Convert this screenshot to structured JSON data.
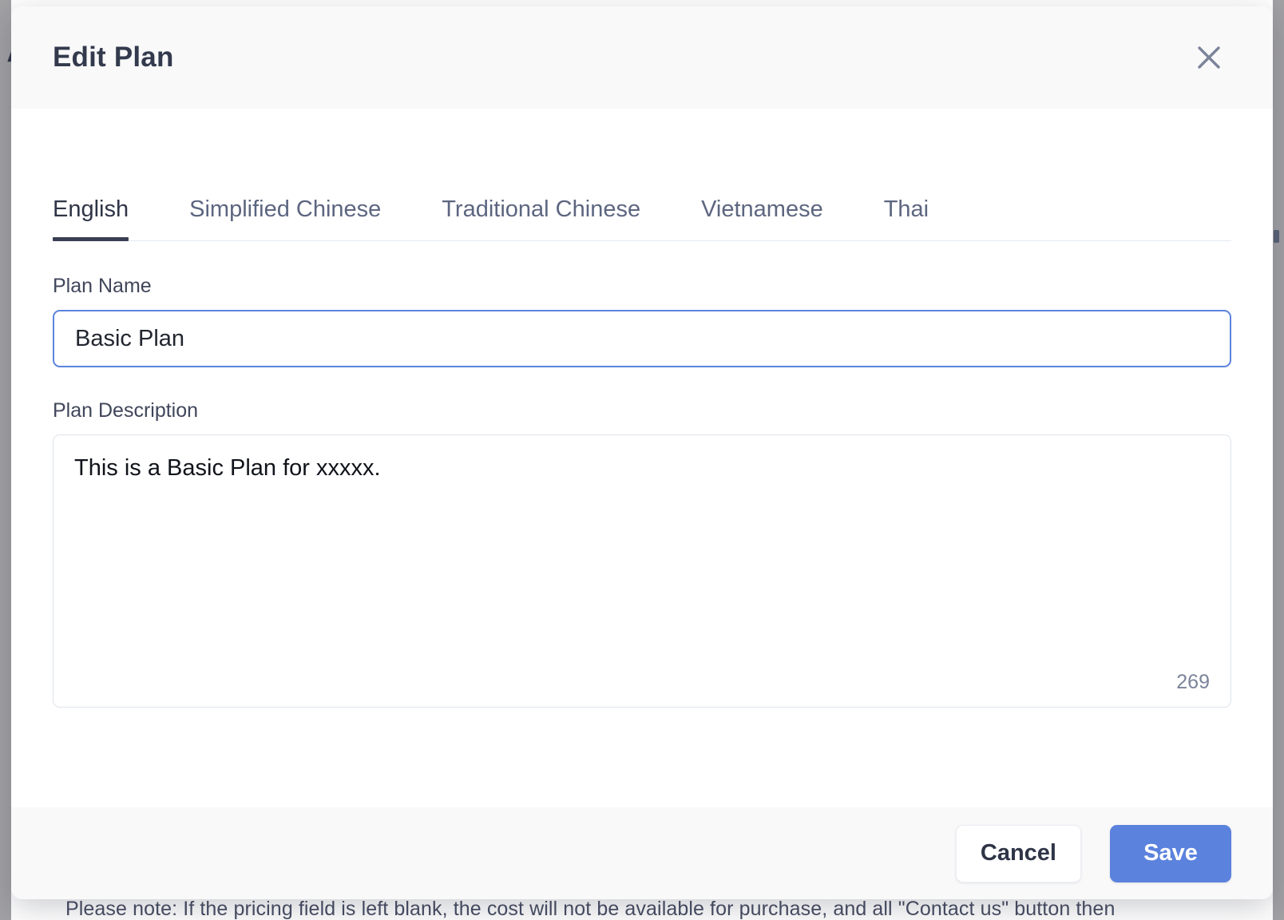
{
  "background": {
    "clipped_text_bottom": "Please note: If the pricing field is left blank, the cost will not be available for purchase, and all \"Contact us\" button then",
    "letter_fragment_top": "A",
    "letter_fragment_second": "I"
  },
  "modal": {
    "title": "Edit Plan",
    "close_icon": "close-icon",
    "tabs": [
      {
        "label": "English",
        "active": true
      },
      {
        "label": "Simplified Chinese",
        "active": false
      },
      {
        "label": "Traditional Chinese",
        "active": false
      },
      {
        "label": "Vietnamese",
        "active": false
      },
      {
        "label": "Thai",
        "active": false
      }
    ],
    "fields": {
      "plan_name": {
        "label": "Plan Name",
        "value": "Basic Plan",
        "placeholder": "Plan Name"
      },
      "plan_description": {
        "label": "Plan Description",
        "value": "This is a Basic Plan for xxxxx.",
        "placeholder": "Plan Description",
        "char_counter": "269"
      }
    },
    "footer": {
      "cancel_label": "Cancel",
      "save_label": "Save"
    }
  },
  "colors": {
    "accent_blue": "#5b82dd",
    "title_slate": "#333a4d",
    "tab_inactive": "#5d6680",
    "tab_active_underline": "#3a3f54",
    "counter_gray": "#7b8499",
    "backdrop_gray": "#a2a2a5",
    "header_footer_bg": "#f9f9fa"
  }
}
